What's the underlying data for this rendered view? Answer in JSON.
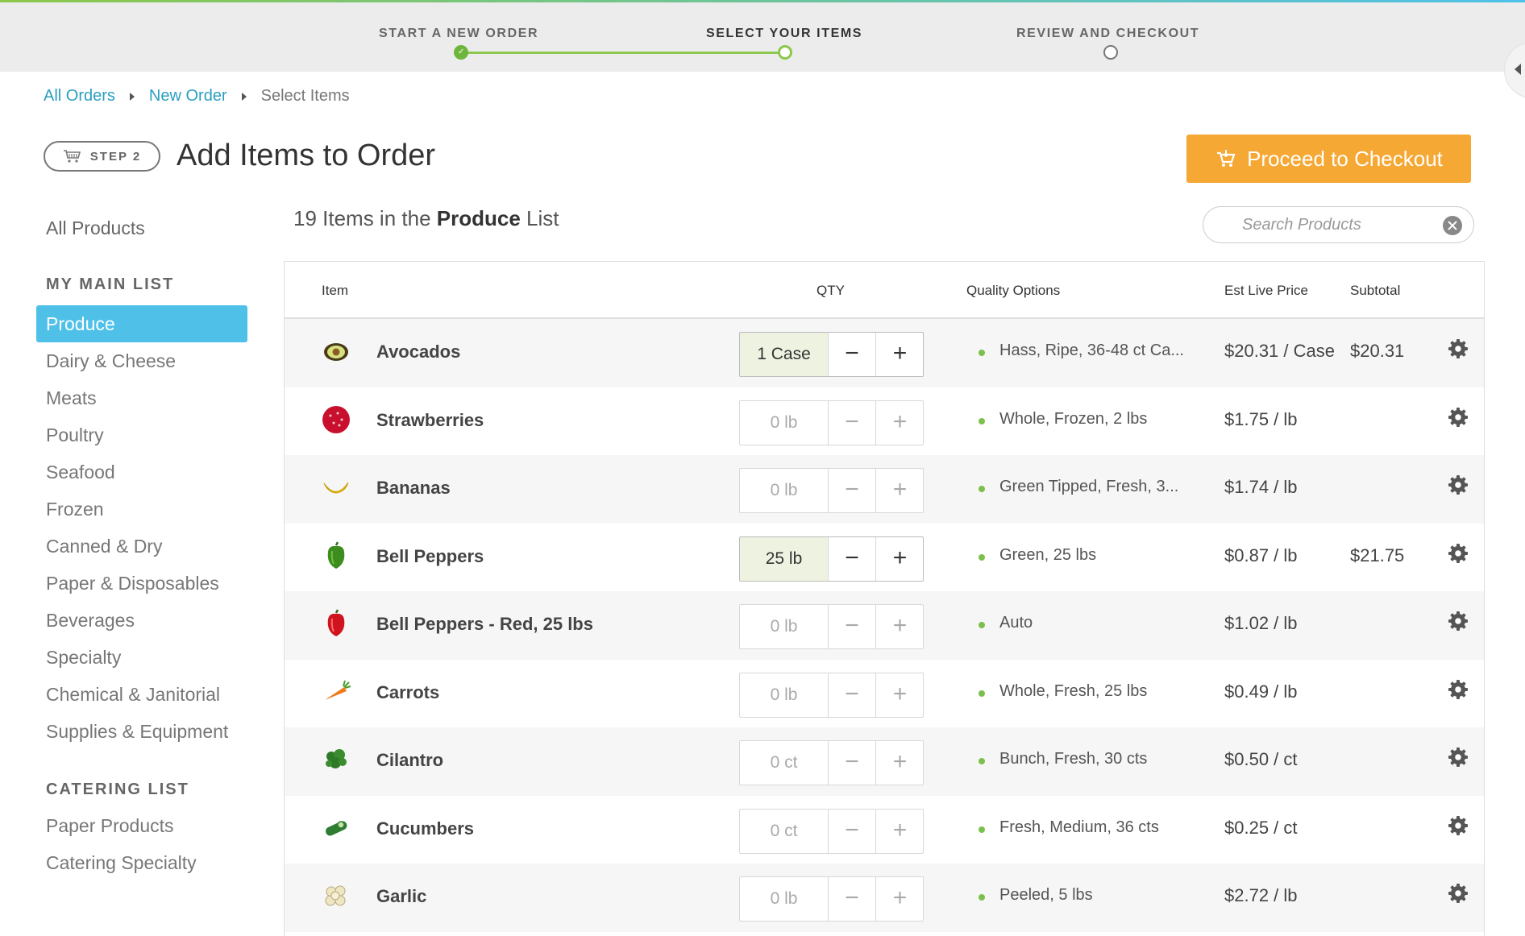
{
  "progress": {
    "steps": [
      {
        "label": "START A NEW ORDER",
        "state": "done"
      },
      {
        "label": "SELECT YOUR ITEMS",
        "state": "current"
      },
      {
        "label": "REVIEW AND CHECKOUT",
        "state": "pending"
      }
    ]
  },
  "breadcrumb": {
    "all_orders": "All Orders",
    "new_order": "New Order",
    "current": "Select Items"
  },
  "header": {
    "step_badge": "STEP 2",
    "title": "Add Items to Order",
    "checkout_label": "Proceed to Checkout"
  },
  "colors": {
    "accent_blue": "#4fc1e9",
    "accent_green": "#8cc84b",
    "checkout_orange": "#f5a833",
    "link": "#2a9fbf"
  },
  "sidebar": {
    "all_products": "All Products",
    "main_list_heading": "MY MAIN LIST",
    "main_items": [
      {
        "label": "Produce",
        "active": true
      },
      {
        "label": "Dairy & Cheese"
      },
      {
        "label": "Meats"
      },
      {
        "label": "Poultry"
      },
      {
        "label": "Seafood"
      },
      {
        "label": "Frozen"
      },
      {
        "label": "Canned & Dry"
      },
      {
        "label": "Paper & Disposables"
      },
      {
        "label": "Beverages"
      },
      {
        "label": "Specialty"
      },
      {
        "label": "Chemical & Janitorial"
      },
      {
        "label": "Supplies & Equipment"
      }
    ],
    "catering_heading": "CATERING LIST",
    "catering_items": [
      {
        "label": "Paper Products"
      },
      {
        "label": "Catering Specialty"
      }
    ]
  },
  "list": {
    "count_prefix": "19 Items in the",
    "list_name": "Produce",
    "suffix": "List"
  },
  "search": {
    "placeholder": "Search Products",
    "value": ""
  },
  "table": {
    "columns": {
      "item": "Item",
      "qty": "QTY",
      "quality": "Quality Options",
      "price": "Est Live Price",
      "subtotal": "Subtotal"
    },
    "rows": [
      {
        "name": "Avocados",
        "icon": "avocado-icon",
        "qty": "1 Case",
        "filled": true,
        "quality": "Hass, Ripe, 36-48 ct Ca...",
        "price": "$20.31 / Case",
        "subtotal": "$20.31"
      },
      {
        "name": "Strawberries",
        "icon": "strawberry-icon",
        "qty": "0 lb",
        "filled": false,
        "quality": "Whole, Frozen, 2 lbs",
        "price": "$1.75 / lb",
        "subtotal": ""
      },
      {
        "name": "Bananas",
        "icon": "banana-icon",
        "qty": "0 lb",
        "filled": false,
        "quality": "Green Tipped, Fresh, 3...",
        "price": "$1.74 / lb",
        "subtotal": ""
      },
      {
        "name": "Bell Peppers",
        "icon": "green-pepper-icon",
        "qty": "25 lb",
        "filled": true,
        "quality": "Green, 25 lbs",
        "price": "$0.87 / lb",
        "subtotal": "$21.75"
      },
      {
        "name": "Bell Peppers - Red, 25 lbs",
        "icon": "red-pepper-icon",
        "qty": "0 lb",
        "filled": false,
        "quality": "Auto",
        "price": "$1.02 / lb",
        "subtotal": ""
      },
      {
        "name": "Carrots",
        "icon": "carrot-icon",
        "qty": "0 lb",
        "filled": false,
        "quality": "Whole, Fresh, 25 lbs",
        "price": "$0.49 / lb",
        "subtotal": ""
      },
      {
        "name": "Cilantro",
        "icon": "cilantro-icon",
        "qty": "0 ct",
        "filled": false,
        "quality": "Bunch, Fresh, 30 cts",
        "price": "$0.50 / ct",
        "subtotal": ""
      },
      {
        "name": "Cucumbers",
        "icon": "cucumber-icon",
        "qty": "0 ct",
        "filled": false,
        "quality": "Fresh, Medium, 36 cts",
        "price": "$0.25 / ct",
        "subtotal": ""
      },
      {
        "name": "Garlic",
        "icon": "garlic-icon",
        "qty": "0 lb",
        "filled": false,
        "quality": "Peeled, 5 lbs",
        "price": "$2.72 / lb",
        "subtotal": ""
      }
    ]
  }
}
